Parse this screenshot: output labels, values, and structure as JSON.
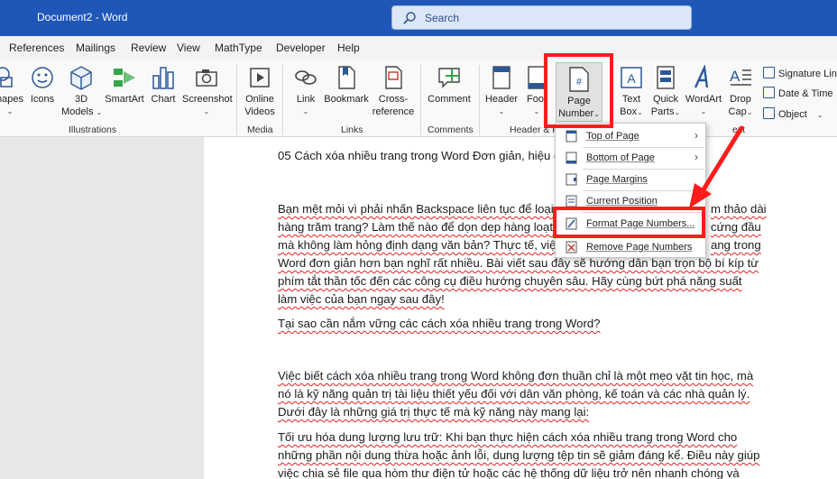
{
  "window": {
    "title": "Document2  -  Word"
  },
  "search": {
    "placeholder": "Search"
  },
  "menu": {
    "tabs": [
      "References",
      "Mailings",
      "Review",
      "View",
      "MathType",
      "Developer",
      "Help"
    ]
  },
  "ribbon": {
    "shapes": "hapes",
    "icons": "Icons",
    "models_3d": [
      "3D",
      "Models"
    ],
    "smartart": "SmartArt",
    "chart": "Chart",
    "screenshot": "Screenshot",
    "online_videos": [
      "Online",
      "Videos"
    ],
    "link": "Link",
    "bookmark": "Bookmark",
    "cross_reference": [
      "Cross-",
      "reference"
    ],
    "comment": "Comment",
    "header": "Header",
    "footer": "Foot",
    "page_number": [
      "Page",
      "Number"
    ],
    "text_box": [
      "Text",
      "Box"
    ],
    "quick_parts": [
      "Quick",
      "Parts"
    ],
    "wordart": "WordArt",
    "drop_cap": [
      "Drop",
      "Cap"
    ],
    "signature_line": "Signature Line",
    "date_time": "Date & Time",
    "object": "Object",
    "groups": {
      "illustrations": "Illustrations",
      "media": "Media",
      "links": "Links",
      "comments": "Comments",
      "header_footer": "Header & F",
      "text": "ext"
    }
  },
  "dropdown": {
    "items": [
      "Top of Page",
      "Bottom of Page",
      "Page Margins",
      "Current Position",
      "Format Page Numbers...",
      "Remove Page Numbers"
    ]
  },
  "document": {
    "lines": [
      "05 Cách xóa nhiều trang trong Word Đơn giản, hiệu q",
      "Bạn mệt mỏi vì phải nhấn Backspace liên tục để loại",
      "m thảo dài",
      "hàng trăm trang? Làm thế nào để dọn dẹp hàng loạt",
      "cứng đầu",
      "mà không làm hỏng định dạng văn bản? Thực tế, việc",
      "ang trong",
      "Word đơn giản hơn bạn nghĩ rất nhiều. Bài viết sau đây sẽ hướng dẫn bạn trọn bộ bí kíp từ",
      "phím tắt thần tốc đến các công cụ điều hướng chuyên sâu. Hãy cùng bứt phá năng suất",
      "làm việc của bạn ngay sau đây!",
      "Tại sao cần nắm vững các cách xóa nhiều trang trong Word?",
      "Việc biết cách xóa nhiều trang trong Word không đơn thuần chỉ là một mẹo vặt tin học, mà",
      "nó là kỹ năng quản trị tài liệu thiết yếu đối với dân văn phòng, kế toán và các nhà quản lý.",
      "Dưới đây là những giá trị thực tế mà kỹ năng này mang lại:",
      "Tối ưu hóa dung lượng lưu trữ: Khi bạn thực hiện cách xóa nhiều trang trong Word cho",
      "những phần nội dung thừa hoặc ảnh lỗi, dung lượng tệp tin sẽ giảm đáng kể. Điều này giúp",
      "việc chia sẻ file qua hòm thư điện tử hoặc các hệ thống dữ liệu trở nên nhanh chóng và"
    ]
  },
  "colors": {
    "titlebar": "#1f57b8",
    "highlight": "#ff1c1c",
    "accent": "#2b5797"
  }
}
